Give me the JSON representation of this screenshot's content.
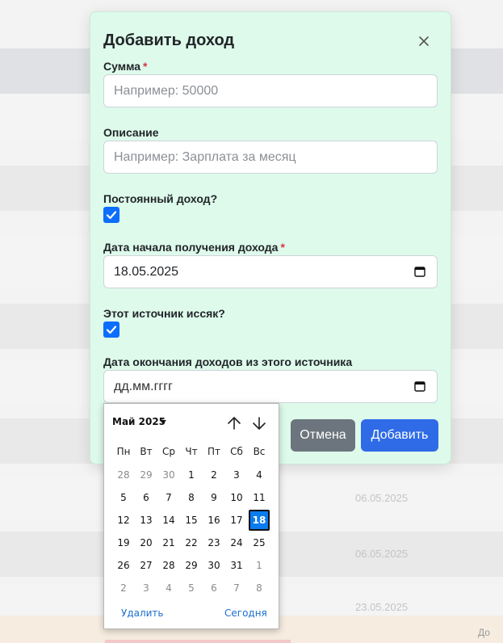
{
  "modal": {
    "title": "Добавить доход",
    "amount_label": "Сумма",
    "amount_placeholder": "Например: 50000",
    "description_label": "Описание",
    "description_placeholder": "Например: Зарплата за месяц",
    "recurring_label": "Постоянный доход?",
    "recurring_checked": true,
    "start_date_label": "Дата начала получения дохода",
    "start_date_value": "18.05.2025",
    "depleted_label": "Этот источник иссяк?",
    "depleted_checked": true,
    "end_date_label": "Дата окончания доходов из этого источника",
    "end_date_value": "дд.мм.гггг",
    "required_mark": "*",
    "cancel_label": "Отмена",
    "add_label": "Добавить"
  },
  "picker": {
    "month_label": "Май 2025",
    "weekdays": [
      "Пн",
      "Вт",
      "Ср",
      "Чт",
      "Пт",
      "Сб",
      "Вс"
    ],
    "weeks": [
      [
        {
          "d": "28",
          "other": true
        },
        {
          "d": "29",
          "other": true
        },
        {
          "d": "30",
          "other": true
        },
        {
          "d": "1"
        },
        {
          "d": "2"
        },
        {
          "d": "3"
        },
        {
          "d": "4"
        }
      ],
      [
        {
          "d": "5"
        },
        {
          "d": "6"
        },
        {
          "d": "7"
        },
        {
          "d": "8"
        },
        {
          "d": "9"
        },
        {
          "d": "10"
        },
        {
          "d": "11"
        }
      ],
      [
        {
          "d": "12"
        },
        {
          "d": "13"
        },
        {
          "d": "14"
        },
        {
          "d": "15"
        },
        {
          "d": "16"
        },
        {
          "d": "17"
        },
        {
          "d": "18",
          "selected": true
        }
      ],
      [
        {
          "d": "19"
        },
        {
          "d": "20"
        },
        {
          "d": "21"
        },
        {
          "d": "22"
        },
        {
          "d": "23"
        },
        {
          "d": "24"
        },
        {
          "d": "25"
        }
      ],
      [
        {
          "d": "26"
        },
        {
          "d": "27"
        },
        {
          "d": "28"
        },
        {
          "d": "29"
        },
        {
          "d": "30"
        },
        {
          "d": "31"
        },
        {
          "d": "1",
          "other": true
        }
      ],
      [
        {
          "d": "2",
          "other": true
        },
        {
          "d": "3",
          "other": true
        },
        {
          "d": "4",
          "other": true
        },
        {
          "d": "5",
          "other": true
        },
        {
          "d": "6",
          "other": true
        },
        {
          "d": "7",
          "other": true
        },
        {
          "d": "8",
          "other": true
        }
      ]
    ],
    "clear_label": "Удалить",
    "today_label": "Сегодня"
  },
  "background": {
    "row_dates": [
      "06.05.2025",
      "06.05.2025",
      "23.05.2025"
    ],
    "footer_text": "До"
  },
  "colors": {
    "modal_bg": "#defaeb",
    "primary": "#2f6be6",
    "secondary": "#6c757d",
    "checkbox": "#0d6efd",
    "selected_day": "#0a7cf0",
    "required": "#dc3545"
  }
}
